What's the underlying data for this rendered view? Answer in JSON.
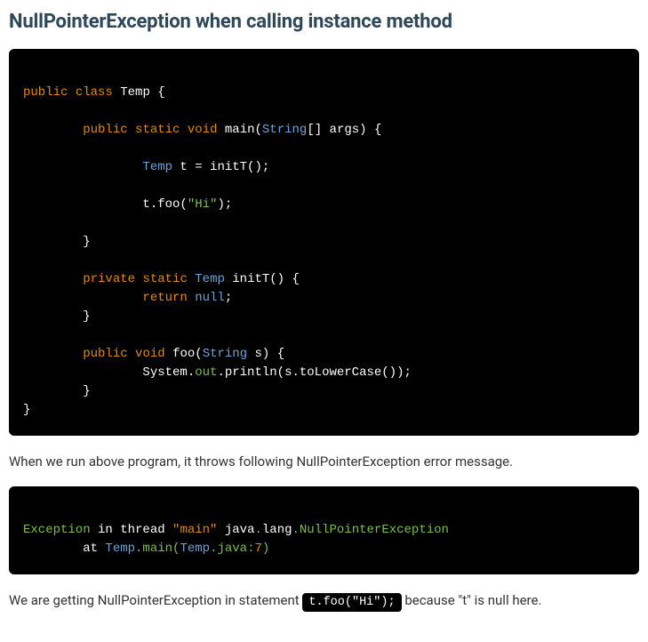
{
  "heading": "NullPointerException when calling instance method",
  "code1": {
    "l1_public": "public",
    "l1_class": "class",
    "l1_name": "Temp",
    "l1_open": " {",
    "main_public": "public",
    "main_static": "static",
    "main_void": "void",
    "main_name": "main",
    "main_paramtype": "String",
    "main_bracket": "[]",
    "main_param": " args",
    "main_decl_type": "Temp",
    "main_decl_rest": " t = initT();",
    "main_call": "t.foo(",
    "main_call_arg": "\"Hi\"",
    "main_call_close": ");",
    "initT_private": "private",
    "initT_static": "static",
    "initT_rettype": "Temp",
    "initT_name": " initT() {",
    "initT_return": "return",
    "initT_null": "null",
    "initT_semi": ";",
    "foo_public": "public",
    "foo_void": "void",
    "foo_name": "foo",
    "foo_paramtype": "String",
    "foo_param": " s",
    "foo_body_pref": "System.",
    "foo_body_out": "out",
    "foo_body_rest": ".println(s.toLowerCase());",
    "close_inner": "}",
    "close_outer": "}"
  },
  "para1": "When we run above program, it throws following NullPointerException error message.",
  "stacktrace": {
    "l1_a": "Exception",
    "l1_b": " in thread ",
    "l1_c": "\"main\"",
    "l1_d": " java",
    "l1_e": ".",
    "l1_f": "lang",
    "l1_g": ".",
    "l1_h": "NullPointerException",
    "l2_a": "        at ",
    "l2_b": "Temp",
    "l2_c": ".main(",
    "l2_d": "Temp",
    "l2_e": ".java:",
    "l2_f": "7",
    "l2_g": ")"
  },
  "para2_a": "We are getting NullPointerException in statement ",
  "para2_code": "t.foo(\"Hi\");",
  "para2_b": " because \"t\" is null here."
}
